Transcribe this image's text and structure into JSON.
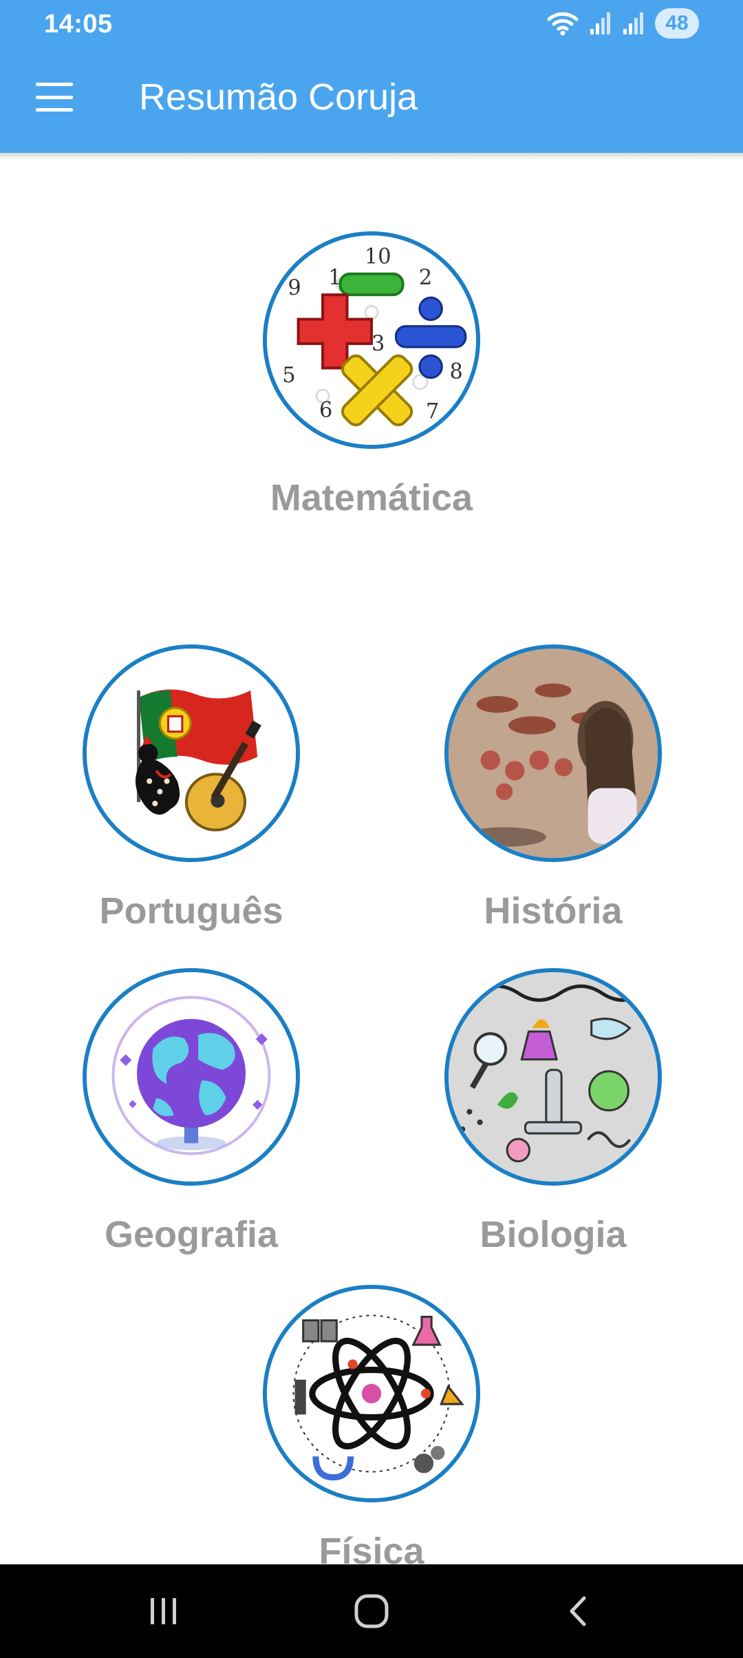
{
  "status_bar": {
    "time": "14:05",
    "battery": "48"
  },
  "app_bar": {
    "title": "Resumão Coruja"
  },
  "subjects": {
    "matematica": "Matemática",
    "portugues": "Português",
    "historia": "História",
    "geografia": "Geografia",
    "biologia": "Biologia",
    "fisica": "Física"
  },
  "colors": {
    "app_bar": "#4aa5ee",
    "ring": "#1b7fc4",
    "label": "#9a9a9a"
  }
}
